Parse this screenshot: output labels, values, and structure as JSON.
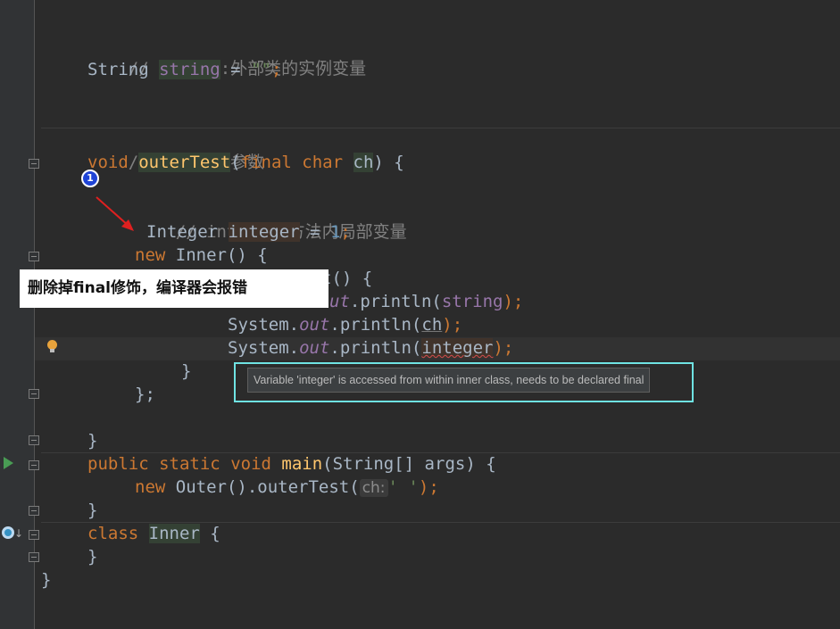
{
  "code": {
    "comment_string": "// string:外部类的实例变量",
    "string_type": "String",
    "string_var": "string",
    "string_assign": " = ",
    "string_value": "\"\"",
    "semi": ";",
    "comment_ch": "//ch:方法的参数",
    "void_kw": "void",
    "method_outer": "outerTest",
    "open_paren": "(",
    "final_kw": "final",
    "char_kw": "char",
    "param_ch": "ch",
    "close_brace_open": ") {",
    "comment_integer": "// integer:方法内局部变量",
    "integer_type": "Integer",
    "integer_var": "integer",
    "assign": " = ",
    "one": "1",
    "new_kw": "new",
    "inner_call": "Inner() {",
    "test_tail": "t() {",
    "println_string_pre": "ut",
    "println_string_post": ".println(",
    "system": "System",
    "dot": ".",
    "out": "out",
    "println": ".println(",
    "arg_string": "string",
    "arg_ch": "ch",
    "arg_integer": "integer",
    "close_semi": ");",
    "brace_close": "}",
    "brace_semi": "};",
    "public_kw": "public",
    "static_kw": "static",
    "void_kw2": "void",
    "main_name": "main",
    "main_params": "(String[] args) {",
    "new_kw2": "new",
    "outer_call": "Outer().outerTest(",
    "hint_ch": "ch:",
    "char_literal": "' '",
    "class_kw": "class",
    "inner_name": "Inner",
    "open_brace": " {"
  },
  "annotation": {
    "badge": "1",
    "note": "删除掉final修饰，编译器会报错"
  },
  "tooltip": {
    "text": "Variable 'integer' is accessed from within inner class, needs to be declared final"
  },
  "gutter_icons": [
    "fold-icon",
    "run-icon",
    "override-icon",
    "lightbulb-icon"
  ],
  "colors": {
    "background": "#2b2b2b",
    "keyword": "#cc7832",
    "string": "#6a8759",
    "comment": "#808080",
    "number": "#6897bb",
    "field": "#9876aa",
    "method": "#ffc66d",
    "arrow": "#e02020",
    "tooltip_frame": "#6fe3e3"
  }
}
